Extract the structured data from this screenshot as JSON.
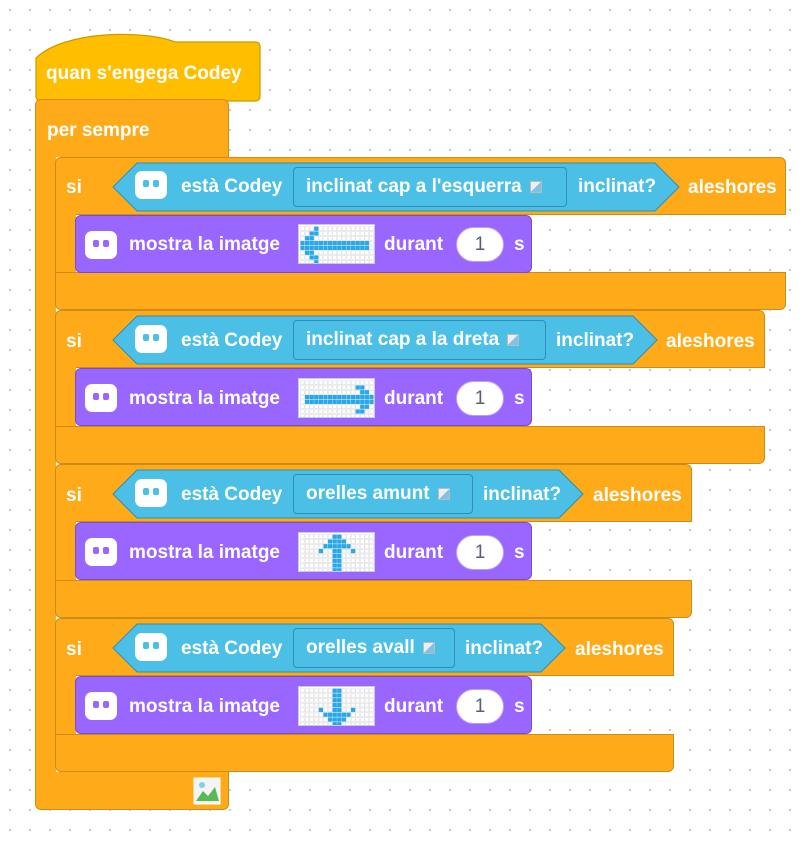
{
  "hat": {
    "label": "quan s'engega Codey"
  },
  "forever": {
    "label": "per sempre"
  },
  "ifs": [
    {
      "if_label": "si",
      "codey_label": "està Codey",
      "tilt_option": "inclinat cap a l'esquerra",
      "tilted_label": "inclinat?",
      "then_label": "aleshores",
      "action": {
        "label": "mostra la imatge",
        "image": "arrow-left",
        "for_label": "durant",
        "seconds": "1",
        "unit": "s"
      }
    },
    {
      "if_label": "si",
      "codey_label": "està Codey",
      "tilt_option": "inclinat cap a la dreta",
      "tilted_label": "inclinat?",
      "then_label": "aleshores",
      "action": {
        "label": "mostra la imatge",
        "image": "arrow-right",
        "for_label": "durant",
        "seconds": "1",
        "unit": "s"
      }
    },
    {
      "if_label": "si",
      "codey_label": "està Codey",
      "tilt_option": "orelles amunt",
      "tilted_label": "inclinat?",
      "then_label": "aleshores",
      "action": {
        "label": "mostra la imatge",
        "image": "arrow-up",
        "for_label": "durant",
        "seconds": "1",
        "unit": "s"
      }
    },
    {
      "if_label": "si",
      "codey_label": "està Codey",
      "tilt_option": "orelles avall",
      "tilted_label": "inclinat?",
      "then_label": "aleshores",
      "action": {
        "label": "mostra la imatge",
        "image": "arrow-down",
        "for_label": "durant",
        "seconds": "1",
        "unit": "s"
      }
    }
  ],
  "colors": {
    "events": "#FFBF00",
    "control": "#FFAB19",
    "sensing": "#4CBFE6",
    "looks": "#9966FF",
    "led": "#2AA7E8"
  }
}
